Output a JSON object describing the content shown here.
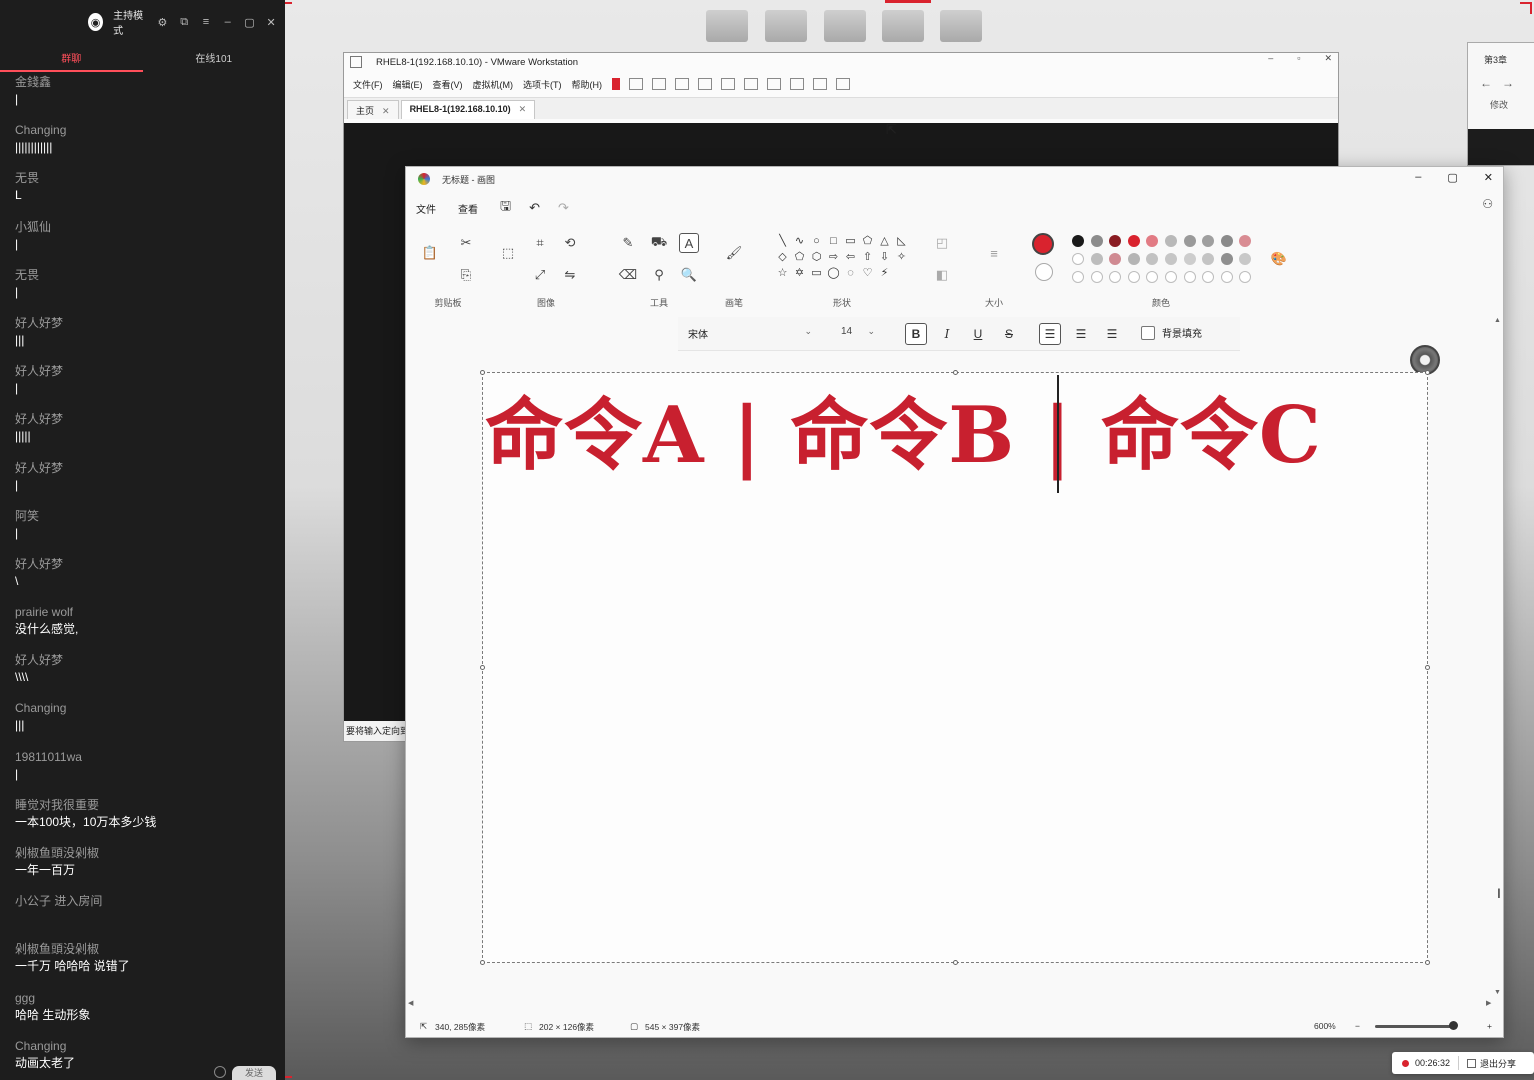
{
  "chat": {
    "mode_label": "主持模式",
    "tabs": [
      "群聊",
      "在线101"
    ],
    "messages": [
      {
        "name": "金錢鑫",
        "text": "|"
      },
      {
        "name": "Changing",
        "text": "||||||||||||"
      },
      {
        "name": "无畏",
        "text": "L"
      },
      {
        "name": "小狐仙",
        "text": "|"
      },
      {
        "name": "无畏",
        "text": "|"
      },
      {
        "name": "好人好梦",
        "text": "|||"
      },
      {
        "name": "好人好梦",
        "text": "|"
      },
      {
        "name": "好人好梦",
        "text": "|||||"
      },
      {
        "name": "好人好梦",
        "text": "|"
      },
      {
        "name": "阿笑",
        "text": "|"
      },
      {
        "name": "好人好梦",
        "text": "\\"
      },
      {
        "name": "prairie wolf",
        "text": "没什么感觉,"
      },
      {
        "name": "好人好梦",
        "text": "\\\\\\\\"
      },
      {
        "name": "Changing",
        "text": "|||"
      },
      {
        "name": "19811011wa",
        "text": "|"
      },
      {
        "name": "睡觉对我很重要",
        "text": "一本100块，10万本多少钱"
      },
      {
        "name": "剁椒鱼頭没剁椒",
        "text": "一年一百万"
      },
      {
        "name": "小公子 进入房间",
        "text": ""
      },
      {
        "name": "剁椒鱼頭没剁椒",
        "text": "一千万   哈哈哈  说错了"
      },
      {
        "name": "ggg",
        "text": "哈哈 生动形象"
      },
      {
        "name": "Changing",
        "text": "动画太老了"
      }
    ],
    "send_label": "发送"
  },
  "vmware": {
    "title": "RHEL8-1(192.168.10.10) - VMware Workstation",
    "menu": [
      "文件(F)",
      "编辑(E)",
      "查看(V)",
      "虚拟机(M)",
      "选项卡(T)",
      "帮助(H)"
    ],
    "tabs": [
      "主页",
      "RHEL8-1(192.168.10.10)"
    ],
    "status_text": "要将输入定向到"
  },
  "browser": {
    "title": "第3章",
    "edit_label": "修改"
  },
  "paint": {
    "title": "无标题 - 画图",
    "menu": [
      "文件",
      "查看"
    ],
    "groups": {
      "clipboard": "剪贴板",
      "image": "图像",
      "tools": "工具",
      "brushes": "画笔",
      "shapes": "形状",
      "size": "大小",
      "colors": "颜色"
    },
    "font_name": "宋体",
    "font_size": "14",
    "bg_fill_label": "背景填充",
    "canvas_text": "命令A | 命令B | 命令C",
    "status": {
      "cursor_pos": "340, 285像素",
      "selection_size": "202 × 126像素",
      "canvas_size": "545 × 397像素",
      "zoom": "600%"
    },
    "colors": {
      "primary": "#d9232e",
      "secondary": "#ffffff",
      "text": "#c8202f",
      "palette_row1": [
        "#1a1a1a",
        "#8c8c8c",
        "#8a1c22",
        "#d9232e",
        "#e27b84",
        "#b9b9b9",
        "#9a9a9a",
        "#9f9f9f",
        "#8a8a8a",
        "#d98c93"
      ],
      "palette_row2": [
        "empty",
        "#bdbdbd",
        "#d08a92",
        "#b5b5b5",
        "#c2c2c2",
        "#c6c6c6",
        "#cdcdcd",
        "#c4c4c4",
        "#8f8f8f",
        "#c8c8c8"
      ],
      "palette_row3": [
        "empty",
        "empty",
        "empty",
        "empty",
        "empty",
        "empty",
        "empty",
        "empty",
        "empty",
        "empty"
      ]
    }
  },
  "recorder": {
    "time": "00:26:32",
    "exit_label": "退出分享"
  }
}
